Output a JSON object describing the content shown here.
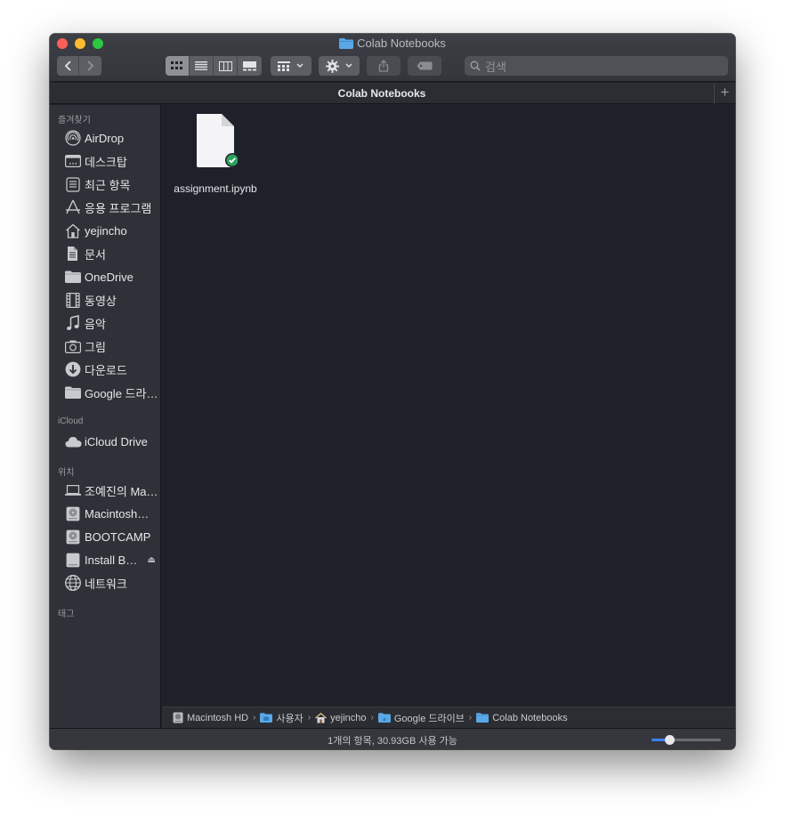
{
  "window": {
    "title": "Colab Notebooks"
  },
  "toolbar": {
    "view_modes": [
      "icon",
      "list",
      "column",
      "gallery"
    ],
    "active_view": "icon",
    "search_placeholder": "검색"
  },
  "tab": {
    "title": "Colab Notebooks"
  },
  "sidebar": {
    "favorites_heading": "즐겨찾기",
    "favorites": [
      {
        "label": "AirDrop",
        "icon": "airdrop-icon"
      },
      {
        "label": "데스크탑",
        "icon": "desktop-icon"
      },
      {
        "label": "최근 항목",
        "icon": "recents-icon"
      },
      {
        "label": "응용 프로그램",
        "icon": "applications-icon"
      },
      {
        "label": "yejincho",
        "icon": "home-icon"
      },
      {
        "label": "문서",
        "icon": "documents-icon"
      },
      {
        "label": "OneDrive",
        "icon": "folder-icon"
      },
      {
        "label": "동영상",
        "icon": "movies-icon"
      },
      {
        "label": "음악",
        "icon": "music-icon"
      },
      {
        "label": "그림",
        "icon": "pictures-icon"
      },
      {
        "label": "다운로드",
        "icon": "downloads-icon"
      },
      {
        "label": "Google 드라…",
        "icon": "folder-icon"
      }
    ],
    "icloud_heading": "iCloud",
    "icloud": [
      {
        "label": "iCloud Drive",
        "icon": "icloud-icon"
      }
    ],
    "locations_heading": "위치",
    "locations": [
      {
        "label": "조예진의 Ma…",
        "icon": "laptop-icon"
      },
      {
        "label": "Macintosh…",
        "icon": "disk-icon"
      },
      {
        "label": "BOOTCAMP",
        "icon": "disk-icon"
      },
      {
        "label": "Install B…",
        "icon": "external-disk-icon"
      },
      {
        "label": "네트워크",
        "icon": "network-icon"
      }
    ],
    "tags_heading": "태그"
  },
  "files": [
    {
      "name": "assignment.ipynb",
      "icon": "document-icon",
      "status": "synced"
    }
  ],
  "pathbar": {
    "crumbs": [
      {
        "label": "Macintosh HD",
        "icon": "disk-icon"
      },
      {
        "label": "사용자",
        "icon": "folder-icon"
      },
      {
        "label": "yejincho",
        "icon": "home-icon"
      },
      {
        "label": "Google 드라이브",
        "icon": "folder-icon"
      },
      {
        "label": "Colab Notebooks",
        "icon": "folder-icon"
      }
    ]
  },
  "status": {
    "text": "1개의 항목, 30.93GB 사용 가능",
    "icon_size_level": 0.25
  },
  "colors": {
    "accent": "#3b82f6",
    "folder": "#5aa9e6",
    "sync_badge": "#27a35a"
  }
}
